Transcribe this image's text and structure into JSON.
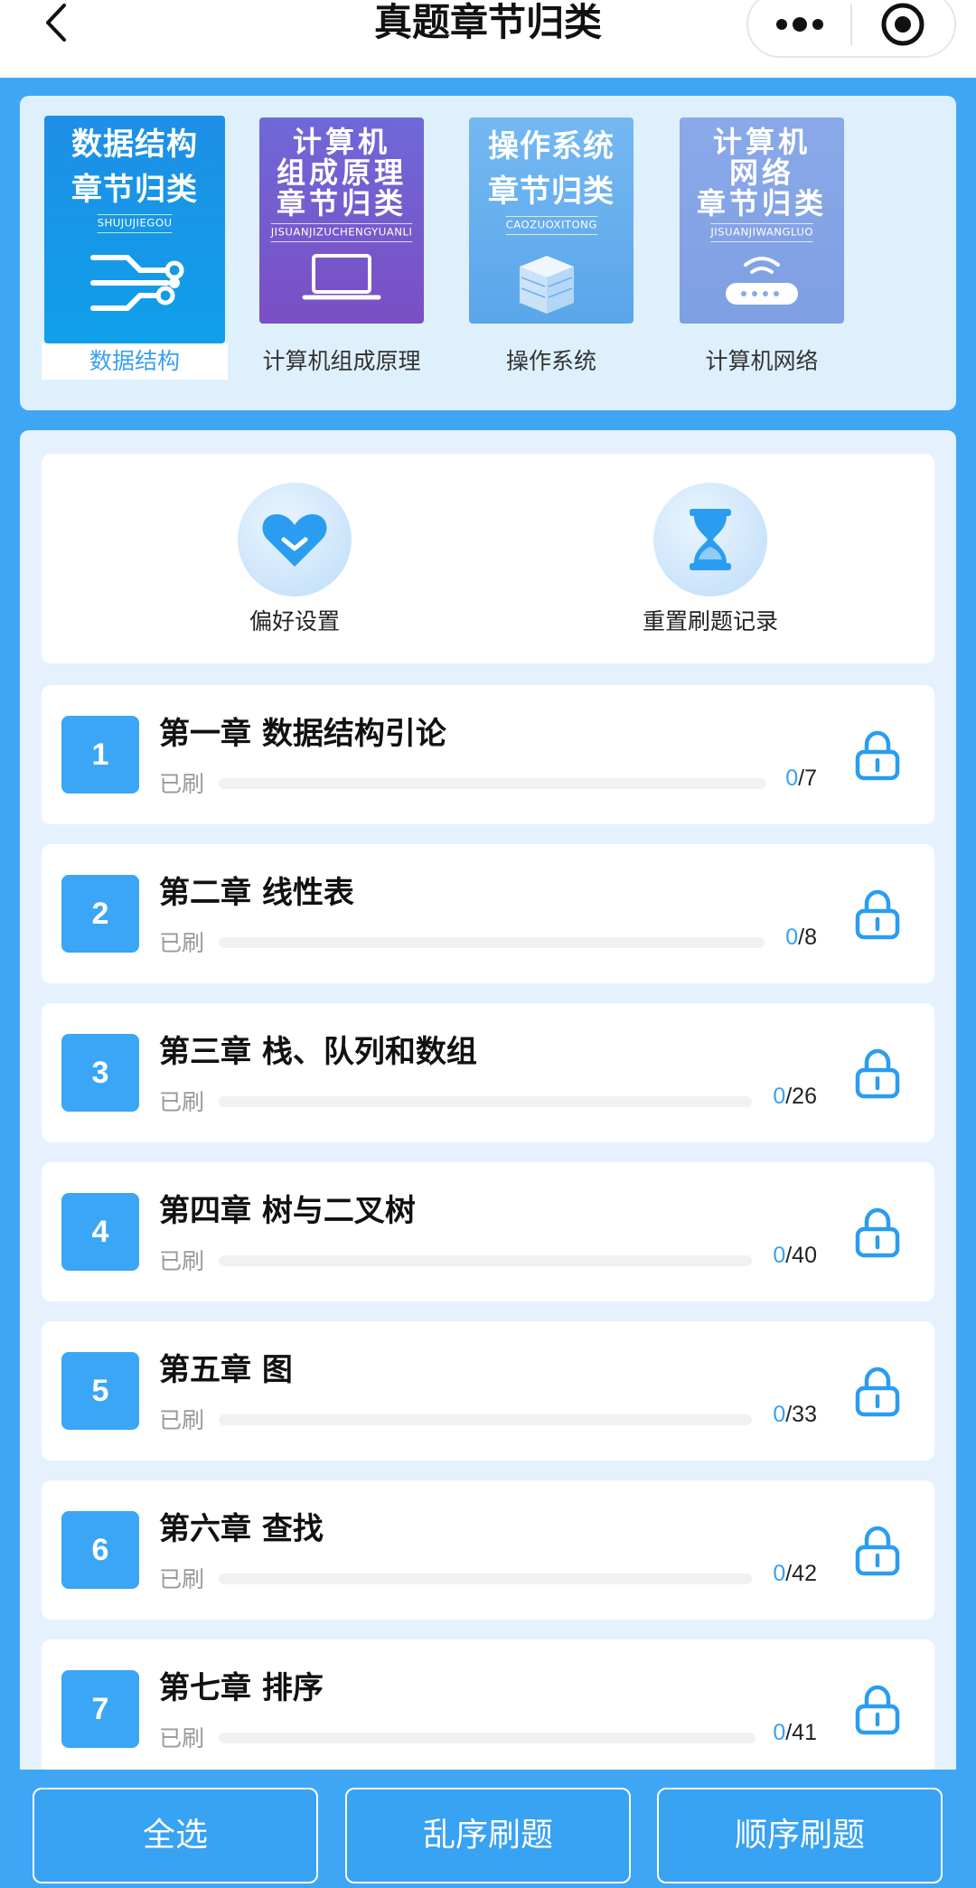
{
  "nav": {
    "title": "真题章节归类"
  },
  "subjects": [
    {
      "label": "数据结构",
      "cover_lines": [
        "数据结构",
        "章节归类"
      ],
      "pinyin": "SHUJUJIEGOU",
      "art": "circuit-icon",
      "bg": "#1a90e8"
    },
    {
      "label": "计算机组成原理",
      "cover_lines": [
        "计算机",
        "组成原理",
        "章节归类"
      ],
      "pinyin": "JISUANJIZUCHENGYUANLI",
      "art": "laptop-icon",
      "bg": "#6a5bd0"
    },
    {
      "label": "操作系统",
      "cover_lines": [
        "操作系统",
        "章节归类"
      ],
      "pinyin": "CAOZUOXITONG",
      "art": "server-icon",
      "bg": "#6fb4f0"
    },
    {
      "label": "计算机网络",
      "cover_lines": [
        "计算机",
        "网络",
        "章节归类"
      ],
      "pinyin": "JISUANJIWANGLUO",
      "art": "router-icon",
      "bg": "#8aa6e6"
    }
  ],
  "actions": {
    "preferences": "偏好设置",
    "reset": "重置刷题记录"
  },
  "chapters": [
    {
      "num": "1",
      "title": "第一章 数据结构引论",
      "done_label": "已刷",
      "done": "0",
      "total": "/7"
    },
    {
      "num": "2",
      "title": "第二章 线性表",
      "done_label": "已刷",
      "done": "0",
      "total": "/8"
    },
    {
      "num": "3",
      "title": "第三章 栈、队列和数组",
      "done_label": "已刷",
      "done": "0",
      "total": "/26"
    },
    {
      "num": "4",
      "title": "第四章 树与二叉树",
      "done_label": "已刷",
      "done": "0",
      "total": "/40"
    },
    {
      "num": "5",
      "title": "第五章 图",
      "done_label": "已刷",
      "done": "0",
      "total": "/33"
    },
    {
      "num": "6",
      "title": "第六章 查找",
      "done_label": "已刷",
      "done": "0",
      "total": "/42"
    },
    {
      "num": "7",
      "title": "第七章 排序",
      "done_label": "已刷",
      "done": "0",
      "total": "/41"
    }
  ],
  "bottom": {
    "select_all": "全选",
    "random": "乱序刷题",
    "sequential": "顺序刷题"
  },
  "colors": {
    "accent": "#3aa6f5",
    "panel": "#dff0fd"
  }
}
